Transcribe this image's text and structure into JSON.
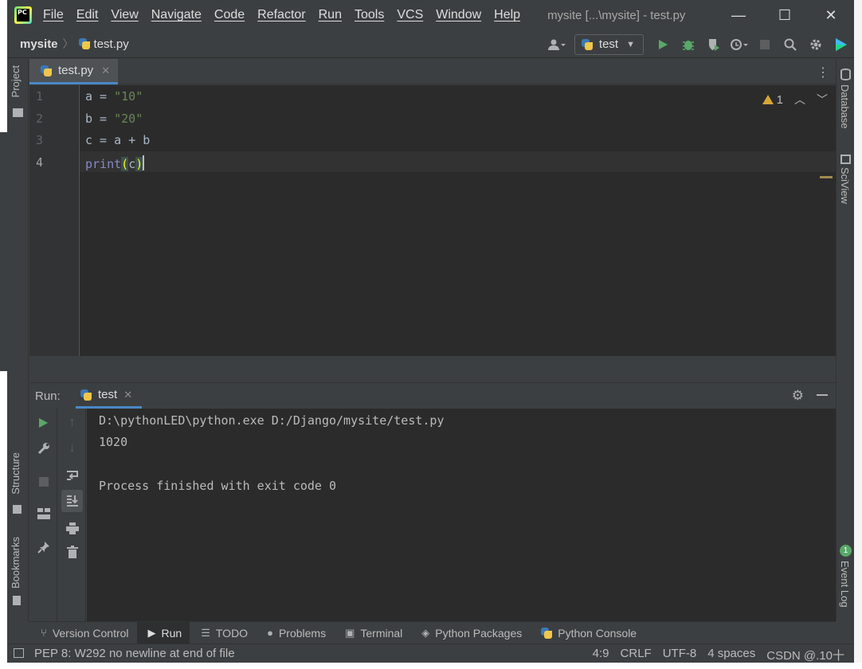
{
  "window": {
    "title": "mysite [...\\mysite] - test.py",
    "logo_text": "PC",
    "controls": {
      "minimize": "—",
      "maximize": "☐",
      "close": "✕"
    }
  },
  "menu": [
    "File",
    "Edit",
    "View",
    "Navigate",
    "Code",
    "Refactor",
    "Run",
    "Tools",
    "VCS",
    "Window",
    "Help"
  ],
  "navbar": {
    "project": "mysite",
    "file": "test.py",
    "run_config": "test"
  },
  "left_stripe": {
    "project_tab": "Project",
    "structure_tab": "Structure",
    "bookmarks_tab": "Bookmarks"
  },
  "right_stripe": {
    "database_tab": "Database",
    "sciview_tab": "SciView",
    "event_log_tab": "Event Log",
    "event_log_count": "1"
  },
  "editor": {
    "tab_label": "test.py",
    "warnings_count": "1",
    "line_numbers": [
      "1",
      "2",
      "3",
      "4"
    ],
    "lines": {
      "l1_pre": "a = ",
      "l1_str": "\"10\"",
      "l2_pre": "b = ",
      "l2_str": "\"20\"",
      "l3": "c = a + b",
      "l4_kw": "print",
      "l4_open": "(",
      "l4_arg": "c",
      "l4_close": ")"
    }
  },
  "run_panel": {
    "label": "Run:",
    "tab_label": "test",
    "console": [
      "D:\\pythonLED\\python.exe D:/Django/mysite/test.py",
      "1020",
      "",
      "Process finished with exit code 0"
    ]
  },
  "bottom_tools": [
    "Version Control",
    "Run",
    "TODO",
    "Problems",
    "Terminal",
    "Python Packages",
    "Python Console"
  ],
  "statusbar": {
    "message": "PEP 8: W292 no newline at end of file",
    "position": "4:9",
    "line_sep": "CRLF",
    "encoding": "UTF-8",
    "indent": "4 spaces",
    "watermark": "CSDN @.10十"
  },
  "colors": {
    "accent": "#4a88c7",
    "run_green": "#59a869",
    "string": "#6a8759",
    "builtin": "#8888c6",
    "warning": "#d5a636"
  }
}
